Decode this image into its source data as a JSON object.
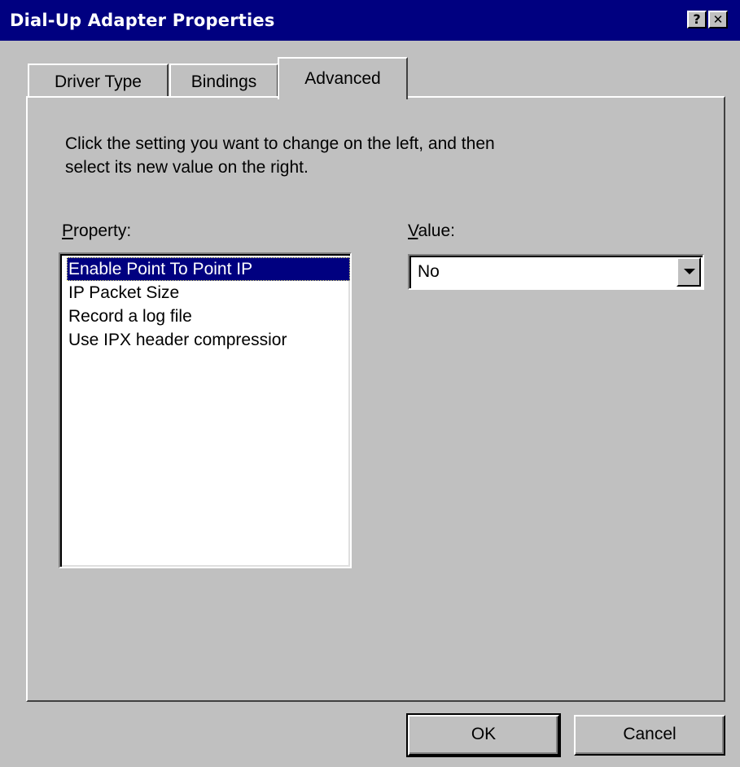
{
  "window": {
    "title": "Dial-Up Adapter Properties",
    "help_button": "?",
    "close_button": "✕"
  },
  "tabs": [
    {
      "label": "Driver Type",
      "active": false
    },
    {
      "label": "Bindings",
      "active": false
    },
    {
      "label": "Advanced",
      "active": true
    }
  ],
  "advanced": {
    "instructions_line1": "Click the setting you want to change on the left, and then",
    "instructions_line2": "select its new value on the right.",
    "property_label_first": "P",
    "property_label_rest": "roperty:",
    "value_label_first": "V",
    "value_label_rest": "alue:",
    "properties": [
      "Enable Point To Point IP",
      "IP Packet Size",
      "Record a log file",
      "Use IPX header compressior"
    ],
    "selected_property_index": 0,
    "value": "No"
  },
  "buttons": {
    "ok": "OK",
    "cancel": "Cancel"
  },
  "colors": {
    "titlebar": "#000080",
    "face": "#c0c0c0",
    "selection": "#000080"
  }
}
